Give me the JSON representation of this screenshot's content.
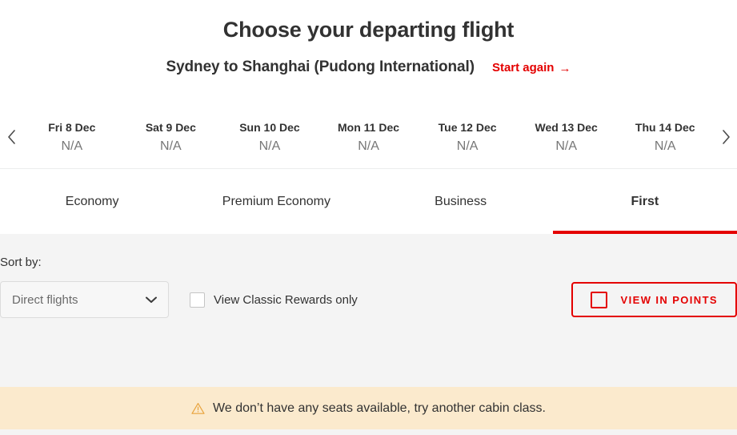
{
  "header": {
    "title": "Choose your departing flight",
    "route": "Sydney to Shanghai (Pudong International)",
    "start_again_label": "Start again",
    "start_again_arrow": "→",
    "link_color": "#e40000"
  },
  "date_strip": {
    "prev_icon": "chevron-left-icon",
    "next_icon": "chevron-right-icon",
    "dates": [
      {
        "label": "Fri 8 Dec",
        "price": "N/A"
      },
      {
        "label": "Sat 9 Dec",
        "price": "N/A"
      },
      {
        "label": "Sun 10 Dec",
        "price": "N/A"
      },
      {
        "label": "Mon 11 Dec",
        "price": "N/A"
      },
      {
        "label": "Tue 12 Dec",
        "price": "N/A"
      },
      {
        "label": "Wed 13 Dec",
        "price": "N/A"
      },
      {
        "label": "Thu 14 Dec",
        "price": "N/A"
      }
    ]
  },
  "tabs": {
    "active_index": 3,
    "active_color": "#e40000",
    "items": [
      {
        "label": "Economy"
      },
      {
        "label": "Premium Economy"
      },
      {
        "label": "Business"
      },
      {
        "label": "First"
      }
    ]
  },
  "filters": {
    "sort_label": "Sort by:",
    "sort_value": "Direct flights",
    "sort_caret_icon": "chevron-down-icon",
    "classic_rewards_label": "View Classic Rewards only",
    "classic_rewards_checked": false,
    "points_button_label": "VIEW IN POINTS",
    "points_button_color": "#e40000"
  },
  "alert": {
    "icon": "warning-triangle-icon",
    "icon_color": "#e8a33d",
    "background": "#fbeacd",
    "message": "We don’t have any seats available, try another cabin class."
  }
}
